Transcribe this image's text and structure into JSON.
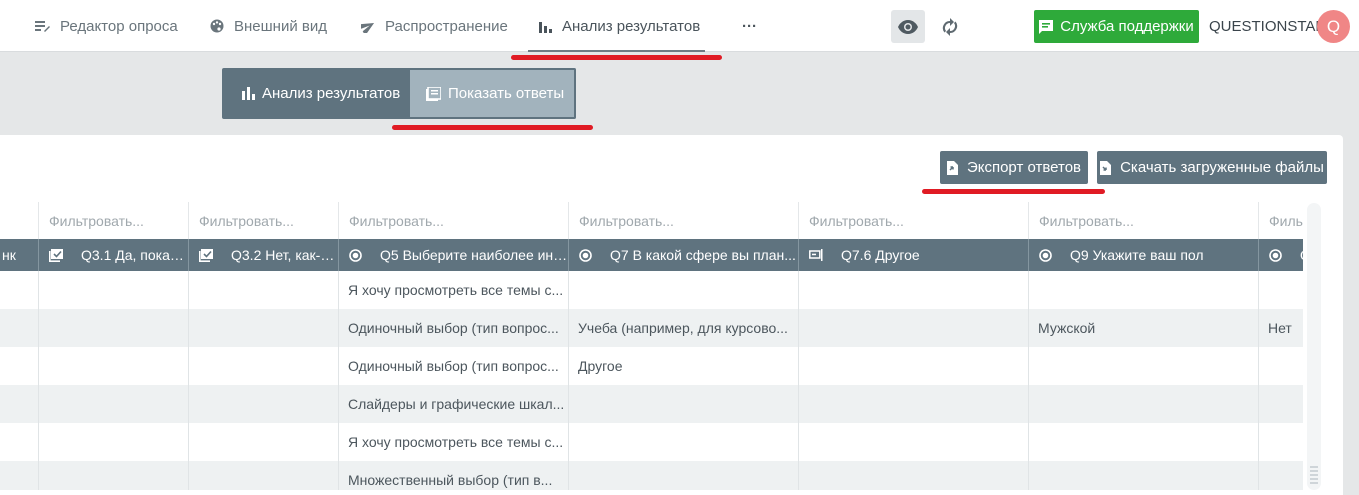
{
  "nav": {
    "items": [
      {
        "label": "Редактор опроса",
        "icon": "edit-lines-icon"
      },
      {
        "label": "Внешний вид",
        "icon": "palette-icon"
      },
      {
        "label": "Распространение",
        "icon": "send-icon"
      },
      {
        "label": "Анализ результатов",
        "icon": "bar-chart-icon"
      }
    ],
    "more_label": "···",
    "support_label": "Служба поддержки",
    "brand": "QUESTIONSTAR",
    "avatar_letter": "Q"
  },
  "toggle": {
    "analysis_label": "Анализ результатов",
    "answers_label": "Показать ответы",
    "selected": "answers"
  },
  "actions": {
    "export_label": "Экспорт ответов",
    "download_label": "Скачать загруженные файлы"
  },
  "grid": {
    "filter_placeholder": "Фильтровать...",
    "filter_partial": "Филь",
    "columns": [
      {
        "label": "нк",
        "icon": "none"
      },
      {
        "label": "Q3.1 Да, покаж...",
        "icon": "image-check-icon"
      },
      {
        "label": "Q3.2 Нет, как-н...",
        "icon": "image-check-icon"
      },
      {
        "label": "Q5 Выберите наиболее инт...",
        "icon": "radio-icon"
      },
      {
        "label": "Q7 В какой сфере вы план...",
        "icon": "radio-icon"
      },
      {
        "label": "Q7.6 Другое",
        "icon": "text-field-icon"
      },
      {
        "label": "Q9 Укажите ваш пол",
        "icon": "radio-icon"
      },
      {
        "label": "Q",
        "icon": "radio-icon"
      }
    ],
    "rows": [
      [
        "",
        "",
        "",
        "Я хочу просмотреть все темы с...",
        "",
        "",
        "",
        ""
      ],
      [
        "",
        "",
        "",
        "Одиночный выбор (тип вопрос...",
        "Учеба (например, для курсово...",
        "",
        "Мужской",
        "Нет"
      ],
      [
        "",
        "",
        "",
        "Одиночный выбор (тип вопрос...",
        "Другое",
        "",
        "",
        ""
      ],
      [
        "",
        "",
        "",
        "Слайдеры и графические шкал...",
        "",
        "",
        "",
        ""
      ],
      [
        "",
        "",
        "",
        "Я хочу просмотреть все темы с...",
        "",
        "",
        "",
        ""
      ],
      [
        "",
        "",
        "",
        "Множественный выбор (тип в...",
        "",
        "",
        "",
        ""
      ]
    ]
  },
  "colors": {
    "accent": "#5f737f",
    "support": "#2eaa3a",
    "highlight": "#e01b24",
    "avatar": "#f08686"
  }
}
